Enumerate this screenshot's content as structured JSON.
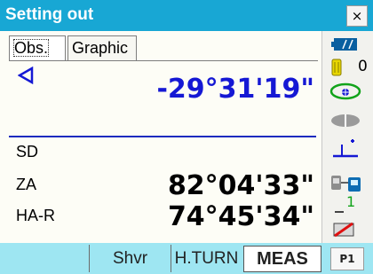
{
  "window": {
    "title": "Setting out",
    "close_label": "×"
  },
  "tabs": [
    {
      "label": "Obs."
    },
    {
      "label": "Graphic"
    }
  ],
  "measurements": {
    "angle_diff": "-29°31'19\"",
    "sd_label": "SD",
    "za_label": "ZA",
    "za_value": "82°04'33\"",
    "har_label": "HA-R",
    "har_value": "74°45'34\""
  },
  "status": {
    "prism_constant": "0",
    "battery": "battery-icon",
    "tilt_icon": "tilt-compensation-icon",
    "target_icon": "prism-target-icon",
    "laser_icon": "laser-plummet-icon",
    "comm_icon": "communication-icon",
    "level": "1",
    "input_icon": "input-mode-icon"
  },
  "softkeys": {
    "key1": "",
    "key2": "Shvr",
    "key3": "H.TURN",
    "key4": "MEAS",
    "page": "P1"
  },
  "colors": {
    "titlebar": "#18a7d4",
    "softbar": "#9ee6f2",
    "value_blue": "#1518d4",
    "divider": "#1a2bbf"
  }
}
